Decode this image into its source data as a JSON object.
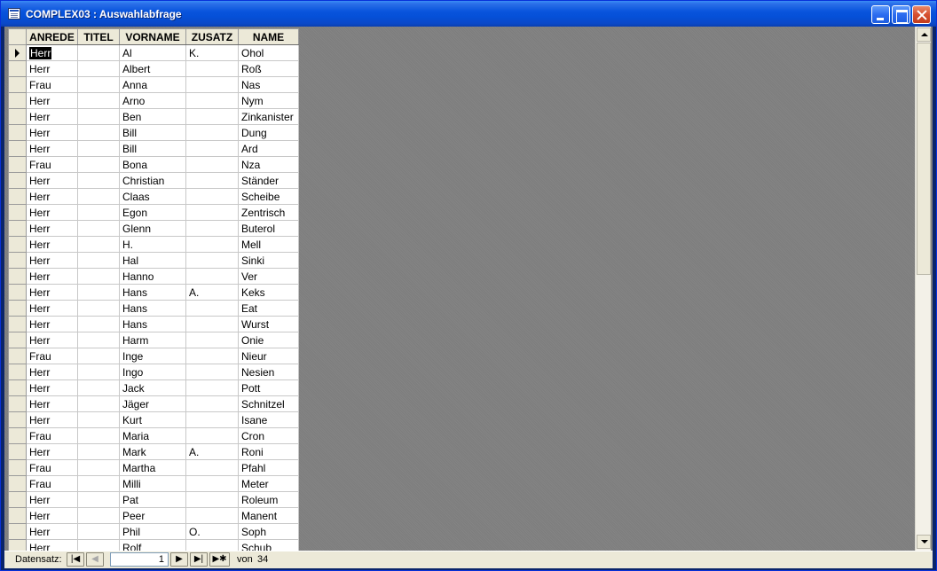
{
  "window": {
    "title": "COMPLEX03 : Auswahlabfrage"
  },
  "grid": {
    "columns": [
      "ANREDE",
      "TITEL",
      "VORNAME",
      "ZUSATZ",
      "NAME"
    ],
    "rows": [
      [
        "Herr",
        "",
        "Al",
        "K.",
        "Ohol"
      ],
      [
        "Herr",
        "",
        "Albert",
        "",
        "Roß"
      ],
      [
        "Frau",
        "",
        "Anna",
        "",
        "Nas"
      ],
      [
        "Herr",
        "",
        "Arno",
        "",
        "Nym"
      ],
      [
        "Herr",
        "",
        "Ben",
        "",
        "Zinkanister"
      ],
      [
        "Herr",
        "",
        "Bill",
        "",
        "Dung"
      ],
      [
        "Herr",
        "",
        "Bill",
        "",
        "Ard"
      ],
      [
        "Frau",
        "",
        "Bona",
        "",
        "Nza"
      ],
      [
        "Herr",
        "",
        "Christian",
        "",
        "Ständer"
      ],
      [
        "Herr",
        "",
        "Claas",
        "",
        "Scheibe"
      ],
      [
        "Herr",
        "",
        "Egon",
        "",
        "Zentrisch"
      ],
      [
        "Herr",
        "",
        "Glenn",
        "",
        "Buterol"
      ],
      [
        "Herr",
        "",
        "H.",
        "",
        "Mell"
      ],
      [
        "Herr",
        "",
        "Hal",
        "",
        "Sinki"
      ],
      [
        "Herr",
        "",
        "Hanno",
        "",
        "Ver"
      ],
      [
        "Herr",
        "",
        "Hans",
        "A.",
        "Keks"
      ],
      [
        "Herr",
        "",
        "Hans",
        "",
        "Eat"
      ],
      [
        "Herr",
        "",
        "Hans",
        "",
        "Wurst"
      ],
      [
        "Herr",
        "",
        "Harm",
        "",
        "Onie"
      ],
      [
        "Frau",
        "",
        "Inge",
        "",
        "Nieur"
      ],
      [
        "Herr",
        "",
        "Ingo",
        "",
        "Nesien"
      ],
      [
        "Herr",
        "",
        "Jack",
        "",
        "Pott"
      ],
      [
        "Herr",
        "",
        "Jäger",
        "",
        "Schnitzel"
      ],
      [
        "Herr",
        "",
        "Kurt",
        "",
        "Isane"
      ],
      [
        "Frau",
        "",
        "Maria",
        "",
        "Cron"
      ],
      [
        "Herr",
        "",
        "Mark",
        "A.",
        "Roni"
      ],
      [
        "Frau",
        "",
        "Martha",
        "",
        "Pfahl"
      ],
      [
        "Frau",
        "",
        "Milli",
        "",
        "Meter"
      ],
      [
        "Herr",
        "",
        "Pat",
        "",
        "Roleum"
      ],
      [
        "Herr",
        "",
        "Peer",
        "",
        "Manent"
      ],
      [
        "Herr",
        "",
        "Phil",
        "O.",
        "Soph"
      ],
      [
        "Herr",
        "",
        "Rolf",
        "",
        "Schub"
      ]
    ],
    "current_row_index": 0
  },
  "navigator": {
    "label": "Datensatz:",
    "current_record": "1",
    "of_label": "von",
    "total": "34"
  },
  "icons": {
    "app": "datasheet-icon",
    "first": "first-record-icon",
    "prev": "previous-record-icon",
    "next": "next-record-icon",
    "last": "last-record-icon",
    "new": "new-record-icon"
  }
}
